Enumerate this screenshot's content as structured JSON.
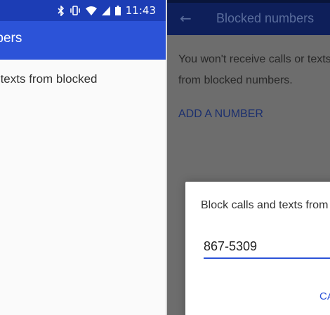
{
  "left_screen": {
    "status_bar": {
      "time": "11:43",
      "icons": [
        "bluetooth-icon",
        "vibrate-icon",
        "wifi-icon",
        "signal-icon",
        "battery-icon"
      ]
    },
    "app_bar": {
      "title": "umbers"
    },
    "body_text": "calls or texts from blocked"
  },
  "right_screen": {
    "app_bar": {
      "back_icon": "arrow-back-icon",
      "title": "Blocked numbers"
    },
    "body_text": "You won't receive calls or texts from blocked numbers.",
    "add_number_label": "ADD A NUMBER",
    "dialog": {
      "title": "Block calls and texts from",
      "input_value": "867-5309",
      "cancel_label": "CANCEL"
    }
  },
  "colors": {
    "primary": "#2c53d8",
    "primary_dark": "#1c3db5",
    "scrim": "#6d6d6d"
  }
}
